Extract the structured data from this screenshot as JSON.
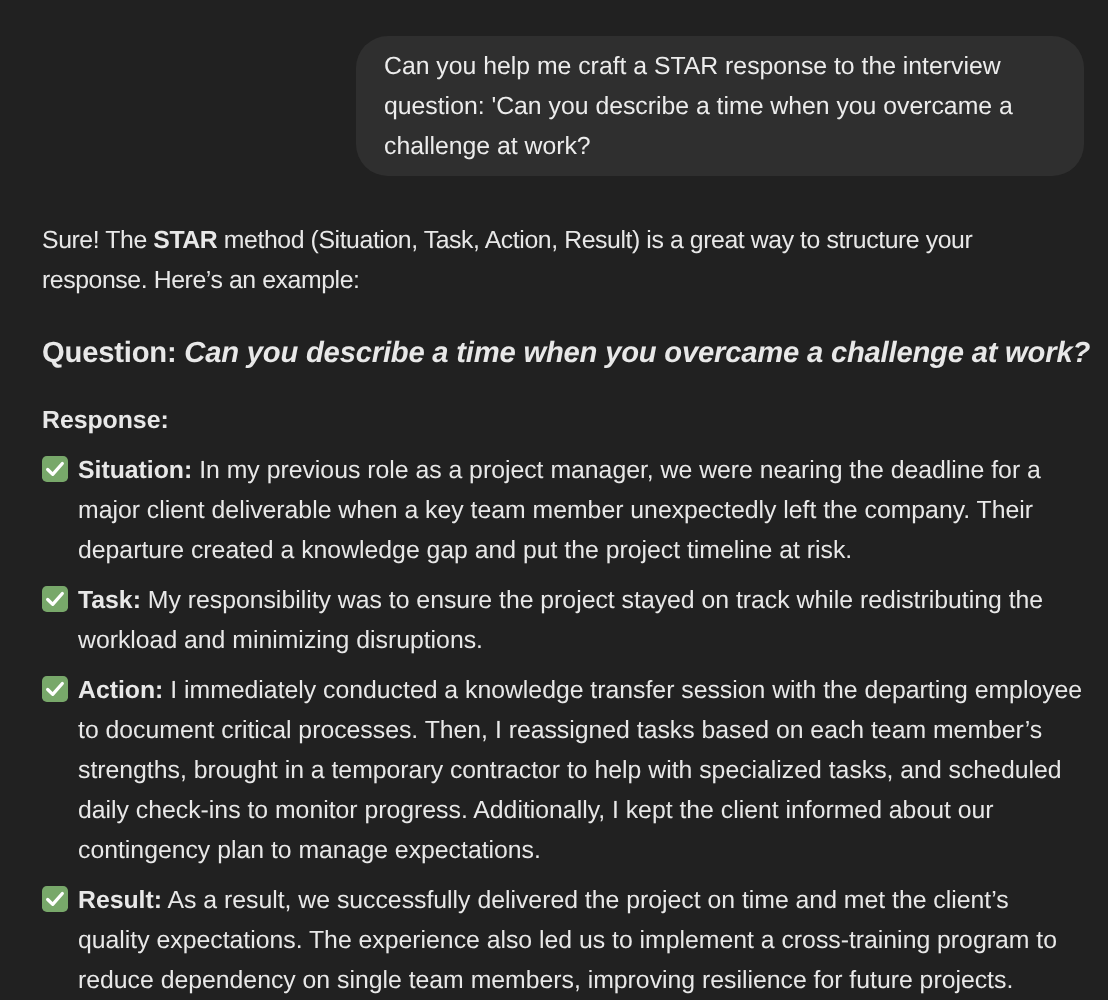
{
  "user_message": "Can you help me craft a STAR response to the interview question: 'Can you describe a time when you overcame a challenge at work?",
  "reply": {
    "intro": "Sure! The **STAR** method (Situation, Task, Action, Result) is a great way to structure your response. Here’s an example:",
    "question": "Question: *Can you describe a time when you overcame a challenge at work?*",
    "response_label": "Response:",
    "items": [
      {
        "label": "Situation:",
        "text": "In my previous role as a project manager, we were nearing the deadline for a major client deliverable when a key team member unexpectedly left the company. Their departure created a knowledge gap and put the project timeline at risk."
      },
      {
        "label": "Task:",
        "text": "My responsibility was to ensure the project stayed on track while redistributing the workload and minimizing disruptions."
      },
      {
        "label": "Action:",
        "text": "I immediately conducted a knowledge transfer session with the departing employee to document critical processes. Then, I reassigned tasks based on each team member’s strengths, brought in a temporary contractor to help with specialized tasks, and scheduled daily check-ins to monitor progress. Additionally, I kept the client informed about our contingency plan to manage expectations."
      },
      {
        "label": "Result:",
        "text": "As a result, we successfully delivered the project on time and met the client’s quality expectations. The experience also led us to implement a cross-training program to reduce dependency on single team members, improving resilience for future projects."
      }
    ]
  }
}
